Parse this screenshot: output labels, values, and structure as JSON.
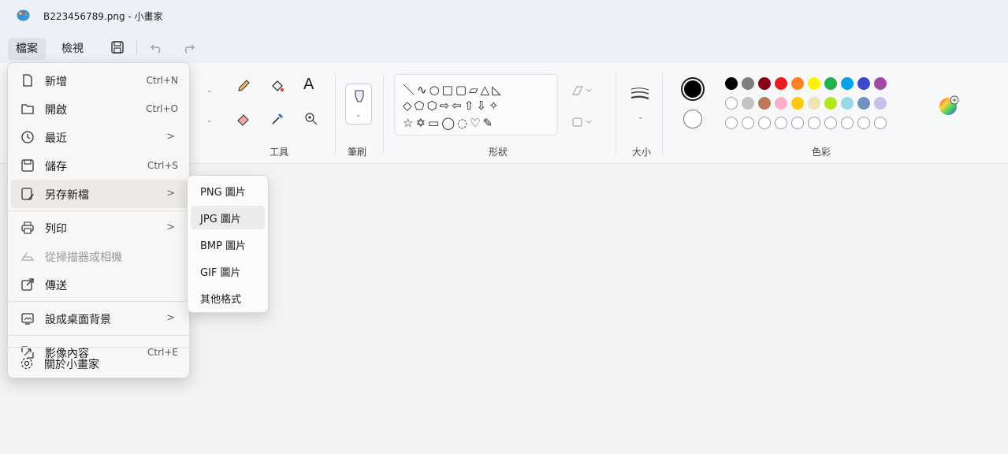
{
  "window": {
    "title": "B223456789.png - 小畫家",
    "app_icon": "paint-palette-icon"
  },
  "menubar": {
    "tabs": [
      {
        "label": "檔案"
      },
      {
        "label": "檢視"
      }
    ],
    "quick_access": [
      "save-icon",
      "undo-icon",
      "redo-icon"
    ]
  },
  "ribbon": {
    "groups": {
      "tools": {
        "label": "工具",
        "icons": [
          "pencil-icon",
          "fill-bucket-icon",
          "text-icon",
          "eraser-icon",
          "color-picker-icon",
          "magnifier-icon"
        ]
      },
      "brushes": {
        "label": "筆刷",
        "icon": "brush-icon"
      },
      "shapes": {
        "label": "形狀",
        "row1": "＼∿○□▢▱△◺",
        "row2": "◇⬠⬡⇨⇦⇧⇩✧",
        "row3": "☆✡▭◯◌♡✎"
      },
      "size": {
        "label": "大小",
        "icon": "stroke-size-icon"
      },
      "colors": {
        "label": "色彩",
        "primary": "#000000",
        "secondary": "#ffffff",
        "row1": [
          "#000000",
          "#7f7f7f",
          "#880015",
          "#ed1c24",
          "#ff7f27",
          "#fff200",
          "#22b14c",
          "#00a2e8",
          "#3f48cc",
          "#a349a4"
        ],
        "row2": [
          "#ffffff",
          "#c3c3c3",
          "#b97a57",
          "#ffaec9",
          "#ffc90e",
          "#efe4b0",
          "#b5e61d",
          "#99d9ea",
          "#7092be",
          "#c8bfe7"
        ],
        "edit_icon": "color-wheel-icon"
      }
    }
  },
  "file_menu": {
    "items": [
      {
        "label": "新增",
        "shortcut": "Ctrl+N",
        "icon": "new-file-icon"
      },
      {
        "label": "開啟",
        "shortcut": "Ctrl+O",
        "icon": "open-folder-icon"
      },
      {
        "label": "最近",
        "arrow": ">",
        "icon": "clock-icon"
      },
      {
        "label": "儲存",
        "shortcut": "Ctrl+S",
        "icon": "save-icon"
      },
      {
        "label": "另存新檔",
        "arrow": ">",
        "icon": "save-as-icon"
      },
      {
        "label": "列印",
        "arrow": ">",
        "icon": "printer-icon"
      },
      {
        "label": "從掃描器或相機",
        "icon": "scanner-icon",
        "disabled": true
      },
      {
        "label": "傳送",
        "icon": "share-icon"
      },
      {
        "label": "設成桌面背景",
        "arrow": ">",
        "icon": "desktop-background-icon"
      },
      {
        "label": "影像內容",
        "shortcut": "Ctrl+E",
        "icon": "image-properties-icon"
      },
      {
        "label": "關於小畫家",
        "icon": "settings-gear-icon"
      }
    ]
  },
  "save_as_submenu": {
    "items": [
      {
        "label": "PNG 圖片"
      },
      {
        "label": "JPG 圖片"
      },
      {
        "label": "BMP 圖片"
      },
      {
        "label": "GIF 圖片"
      },
      {
        "label": "其他格式"
      }
    ]
  }
}
